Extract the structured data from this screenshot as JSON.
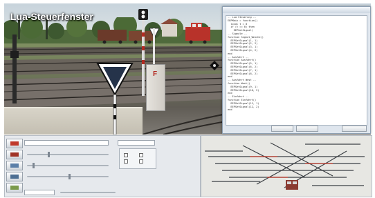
{
  "title": "Lua-Steuerfenster",
  "signs": {
    "sign_f": "F"
  },
  "lua_window": {
    "code_lines": [
      "-- Lua Steuerung --",
      "EEPMain = function()",
      "  local t = 0",
      "  if (t == 0) then",
      "    EEPSetSignal(",
      "",
      "-- Signale --",
      "function Signal_Weiche()",
      "  EEPSetSignal(1, 1)",
      "  EEPSetSignal(2, 2)",
      "  EEPSetSignal(3, 1)",
      "  EEPSetSignal(4, 2)",
      "end",
      "",
      "-- Ausfahrt --",
      "function Ausfahrt()",
      "  EEPSetSignal(5, 1)",
      "  EEPSetSignal(6, 2)",
      "  EEPSetSignal(7, 1)",
      "  EEPSetSignal(8, 2)",
      "end",
      "",
      "-- Ausfahrt West --",
      "function West()",
      "  EEPSetSignal(9, 1)",
      "  EEPSetSignal(10, 2)",
      "end",
      "",
      "-- Einfahrt --",
      "function Einfahrt()",
      "  EEPSetSignal(11, 1)",
      "  EEPSetSignal(12, 2)",
      "end",
      ""
    ]
  },
  "colors": {
    "accent_red": "#c0392b",
    "window_blue": "#cdd7e2",
    "track_dark": "#3b3f44"
  }
}
